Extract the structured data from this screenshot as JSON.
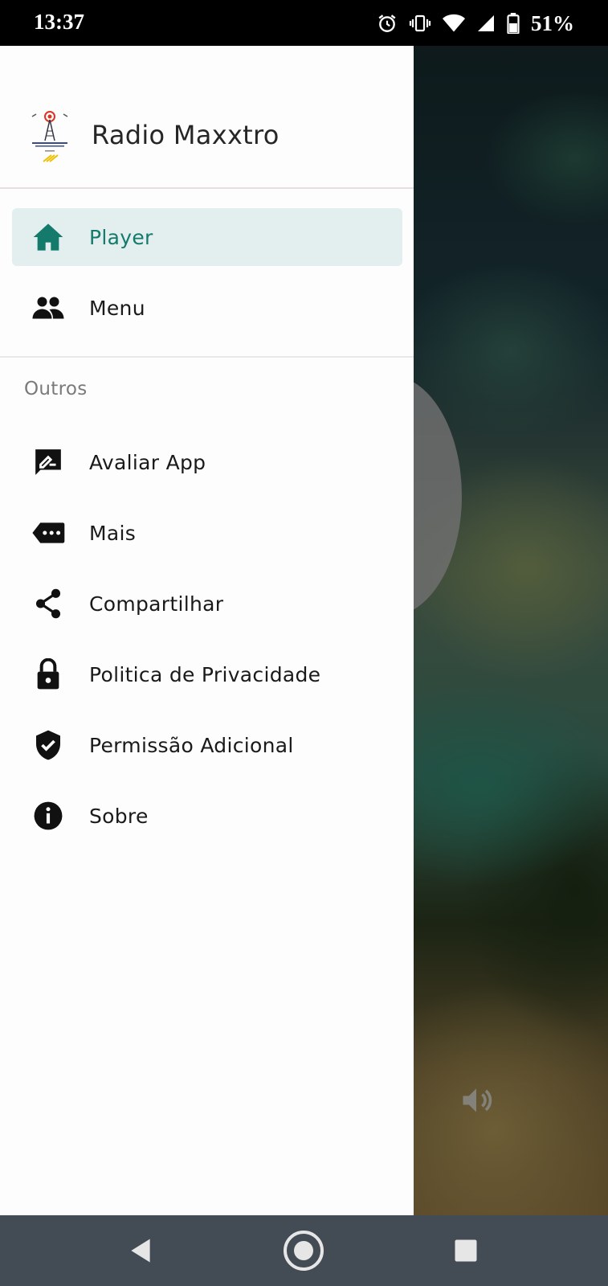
{
  "status_bar": {
    "time": "13:37",
    "battery": "51%"
  },
  "drawer": {
    "app_name": "Radio Maxxtro",
    "primary_items": [
      {
        "label": "Player",
        "icon": "home-icon",
        "active": true
      },
      {
        "label": "Menu",
        "icon": "people-icon",
        "active": false
      }
    ],
    "section_title": "Outros",
    "other_items": [
      {
        "label": "Avaliar App",
        "icon": "rate-review-icon"
      },
      {
        "label": "Mais",
        "icon": "more-label-icon"
      },
      {
        "label": "Compartilhar",
        "icon": "share-icon"
      },
      {
        "label": "Politica de Privacidade",
        "icon": "lock-icon"
      },
      {
        "label": "Permissão Adicional",
        "icon": "shield-check-icon"
      },
      {
        "label": "Sobre",
        "icon": "info-icon"
      }
    ]
  },
  "colors": {
    "accent": "#137a6c",
    "active_bg": "#e3efee",
    "nav_bar": "#434b55"
  }
}
